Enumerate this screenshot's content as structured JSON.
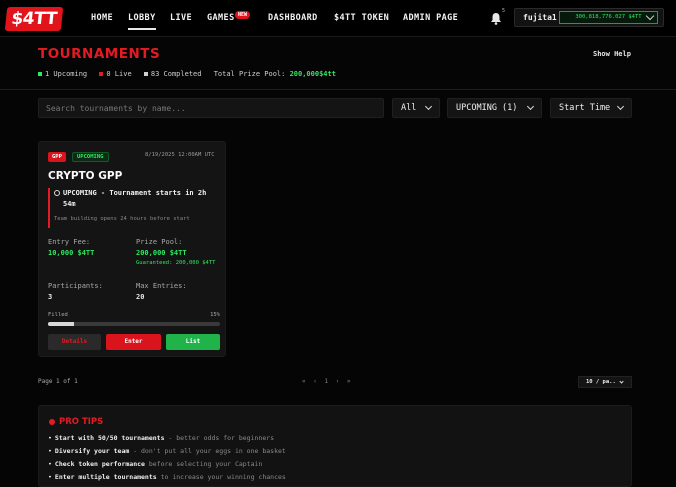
{
  "nav": {
    "logo": "$4TT",
    "items": [
      "HOME",
      "LOBBY",
      "LIVE",
      "GAMES",
      "DASHBOARD",
      "$4TT TOKEN",
      "ADMIN PAGE"
    ],
    "games_badge": "NEW",
    "notifications": "5",
    "username": "fujita1",
    "balance": "300,818,776.027 $4TT"
  },
  "header": {
    "title": "TOURNAMENTS",
    "help": "Show Help",
    "stats": {
      "upcoming": "1 Upcoming",
      "live": "0 Live",
      "completed": "83 Completed",
      "pool_label": "Total Prize Pool:",
      "pool_value": "200,000$4tt"
    }
  },
  "filters": {
    "search_placeholder": "Search tournaments by name...",
    "type": "All",
    "status": "UPCOMING (1)",
    "sort": "Start Time"
  },
  "card": {
    "badge_type": "GPP",
    "badge_status": "UPCOMING",
    "date": "8/19/2025 12:00AM UTC",
    "title": "CRYPTO GPP",
    "notice": "UPCOMING - Tournament starts in 2h 54m",
    "notice_sub": "Team building opens 24 hours before start",
    "entry_fee_label": "Entry Fee:",
    "entry_fee": "10,000 $4TT",
    "prize_pool_label": "Prize Pool:",
    "prize_pool": "200,000 $4TT",
    "guaranteed": "Guaranteed: 200,000 $4TT",
    "participants_label": "Participants:",
    "participants": "3",
    "max_entries_label": "Max Entries:",
    "max_entries": "20",
    "filled_label": "Filled",
    "filled_pct": "15%",
    "filled_fraction": 0.15,
    "btn_details": "Details",
    "btn_enter": "Enter",
    "btn_list": "List"
  },
  "pagination": {
    "page_info": "Page 1 of 1",
    "controls": "«  ‹  1  ›  »",
    "per_page": "10 / pa.."
  },
  "tips": {
    "title": "PRO TIPS",
    "items": [
      {
        "bold": "Start with 50/50 tournaments",
        "rest": " - better odds for beginners"
      },
      {
        "bold": "Diversify your team",
        "rest": " - don't put all your eggs in one basket"
      },
      {
        "bold": "Check token performance",
        "rest": " before selecting your Captain"
      },
      {
        "bold": "Enter multiple tournaments",
        "rest": " to increase your winning chances"
      }
    ]
  },
  "colors": {
    "accent_red": "#e31b23",
    "accent_green": "#2ee860"
  }
}
